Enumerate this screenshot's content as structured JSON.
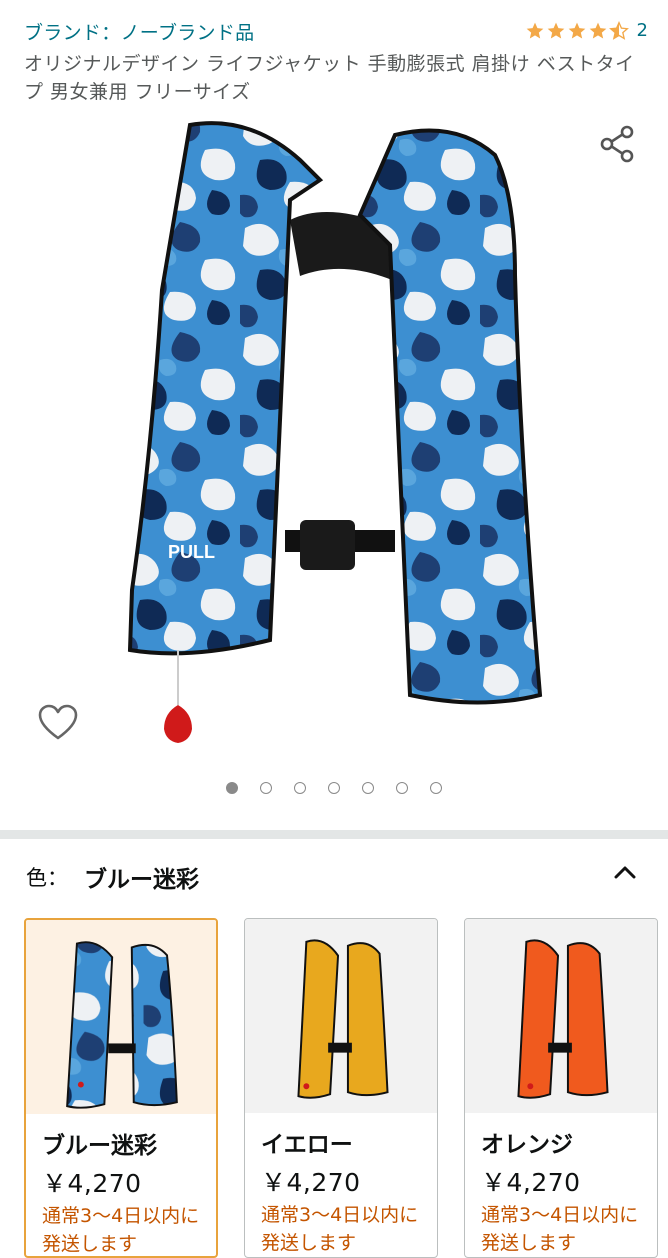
{
  "header": {
    "brand": "ブランド：ノーブランド品",
    "rating_value": 4.5,
    "rating_max": 5,
    "rating_count": "2"
  },
  "product": {
    "title": "オリジナルデザイン ライフジャケット 手動膨張式 肩掛け ベストタイプ 男女兼用 フリーサイズ",
    "image_icon": "life-jacket-blue-camo-image",
    "actions": {
      "share_icon": "share-icon",
      "wishlist_icon": "heart-icon"
    },
    "carousel": {
      "total": 7,
      "active": 1
    }
  },
  "color_selector": {
    "label": "色：",
    "selected": "ブルー迷彩",
    "options": [
      {
        "name": "ブルー迷彩",
        "price": "￥4,270",
        "shipping": "通常3〜4日以内に発送します",
        "color": "#3a86c8",
        "selected": true
      },
      {
        "name": "イエロー",
        "price": "￥4,270",
        "shipping": "通常3〜4日以内に発送します",
        "color": "#e8a81e",
        "selected": false
      },
      {
        "name": "オレンジ",
        "price": "￥4,270",
        "shipping": "通常3〜4日以内に発送します",
        "color": "#f05a1e",
        "selected": false
      }
    ]
  },
  "colors": {
    "link": "#007185",
    "star": "#f3a847",
    "shipping": "#c45500",
    "selected_border": "#e8a33c",
    "separator": "#e3e6e6"
  }
}
